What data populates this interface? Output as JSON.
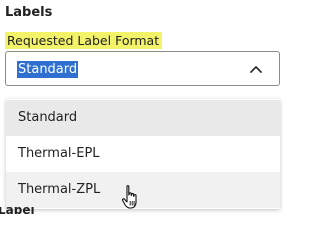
{
  "section": {
    "title": "Labels"
  },
  "field": {
    "label": "Requested Label Format",
    "selected_value": "Standard",
    "expanded": true
  },
  "dropdown": {
    "options": [
      {
        "label": "Standard",
        "state": "selected"
      },
      {
        "label": "Thermal-EPL",
        "state": "normal"
      },
      {
        "label": "Thermal-ZPL",
        "state": "hover"
      }
    ]
  },
  "icons": {
    "chevron": "chevron-up-icon",
    "cursor": "hand-pointer-cursor-icon"
  },
  "colors": {
    "label_highlight": "#f3f36a",
    "text_selection": "#2f6fd0",
    "selected_option_bg": "#e9e9e9",
    "hover_option_bg": "#f1f1f1"
  }
}
